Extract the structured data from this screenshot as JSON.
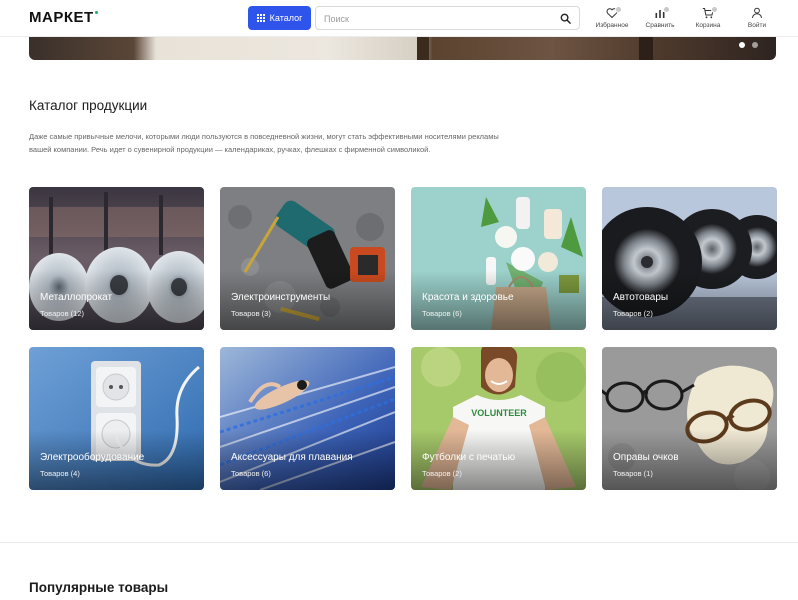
{
  "header": {
    "logo": "маркет",
    "catalog_label": "Каталог",
    "search_placeholder": "Поиск",
    "nav": [
      {
        "label": "Избранное",
        "icon": "heart-icon"
      },
      {
        "label": "Сравнить",
        "icon": "compare-icon"
      },
      {
        "label": "Корзина",
        "icon": "cart-icon"
      },
      {
        "label": "Войти",
        "icon": "user-icon"
      }
    ]
  },
  "hero": {
    "slides": 2,
    "active_slide": 1
  },
  "catalog": {
    "title": "Каталог продукции",
    "description": "Даже самые привычные мелочи, которыми люди пользуются в повседневной жизни, могут стать эффективными носителями рекламы вашей компании. Речь идет о сувенирной продукции — календариках, ручках, флешках с фирменной символикой.",
    "categories": [
      {
        "title": "Металлопрокат",
        "count": "Товаров (12)"
      },
      {
        "title": "Электроинструменты",
        "count": "Товаров (3)"
      },
      {
        "title": "Красота и здоровье",
        "count": "Товаров (6)"
      },
      {
        "title": "Автотовары",
        "count": "Товаров (2)"
      },
      {
        "title": "Электрооборудование",
        "count": "Товаров (4)"
      },
      {
        "title": "Аксессуары для плавания",
        "count": "Товаров (6)"
      },
      {
        "title": "Футболки с печатью",
        "count": "Товаров (2)"
      },
      {
        "title": "Оправы очков",
        "count": "Товаров (1)"
      }
    ],
    "tshirt_print": "VOLUNTEER"
  },
  "popular": {
    "title": "Популярные товары"
  },
  "colors": {
    "accent": "#2f54eb",
    "logo_dot": "#15b36b"
  }
}
